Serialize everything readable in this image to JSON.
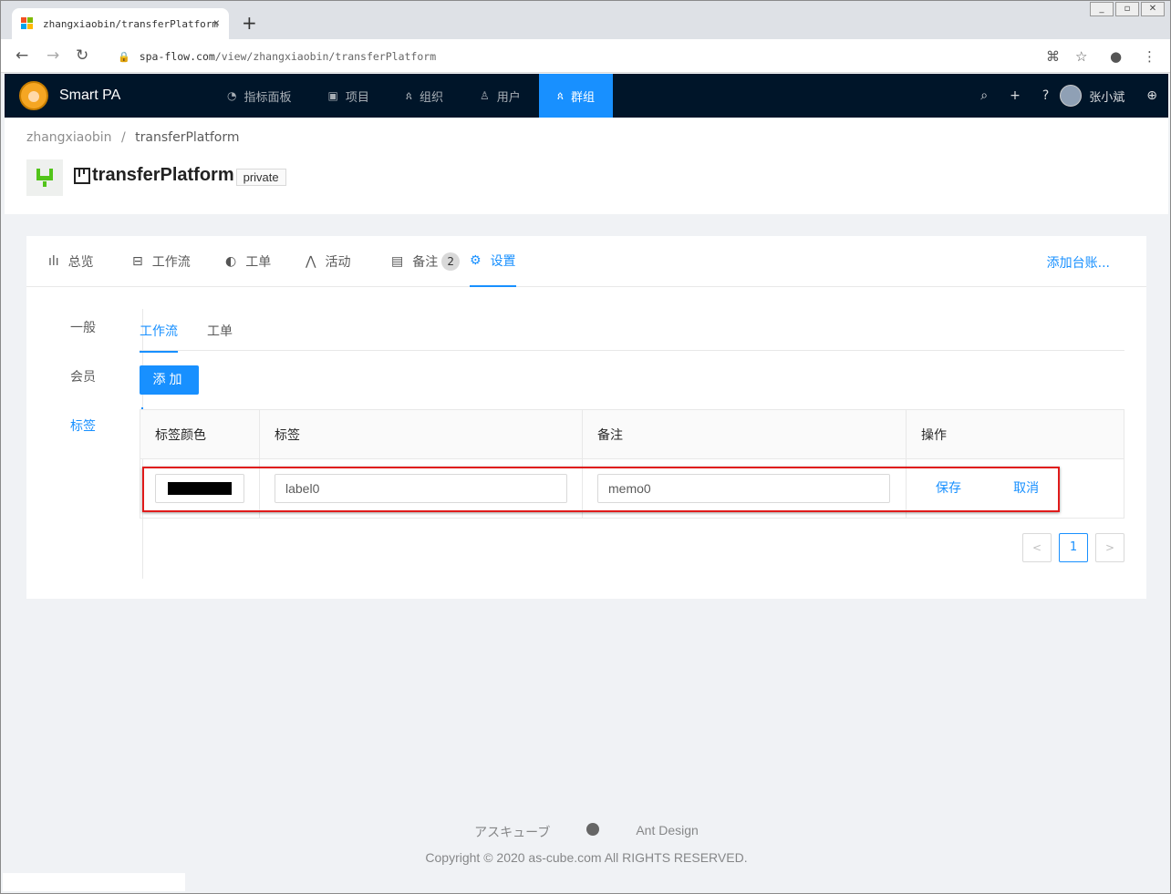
{
  "browser": {
    "tab_title": "zhangxiaobin/transferPlatform",
    "tab_close": "×",
    "new_tab": "+",
    "url_host": "spa-flow.com",
    "url_path": "/view/zhangxiaobin/transferPlatform",
    "back_icon": "←",
    "forward_icon": "→",
    "reload_icon": "↻",
    "lock_icon": "🔒",
    "translate_icon": "⌘",
    "star_icon": "☆",
    "account_icon": "●",
    "menu_icon": "⋮"
  },
  "app": {
    "name": "Smart PA",
    "menu": [
      {
        "label": "指标面板",
        "icon": "◔"
      },
      {
        "label": "项目",
        "icon": "▣"
      },
      {
        "label": "组织",
        "icon": "ጰ"
      },
      {
        "label": "用户",
        "icon": "♙"
      },
      {
        "label": "群组",
        "icon": "ጰ"
      }
    ],
    "header_icons": {
      "search": "⌕",
      "add": "+",
      "help": "?",
      "globe": "⊕"
    },
    "user_name": "张小斌"
  },
  "page": {
    "breadcrumb": [
      "zhangxiaobin",
      "/",
      "transferPlatform"
    ],
    "project_name": "transferPlatform",
    "visibility": "private"
  },
  "card": {
    "tabs": [
      {
        "label": "总览",
        "icon": "ılı"
      },
      {
        "label": "工作流",
        "icon": "⊟"
      },
      {
        "label": "工单",
        "icon": "◐"
      },
      {
        "label": "活动",
        "icon": "⋀"
      },
      {
        "label": "备注",
        "icon": "▤",
        "count": "2"
      },
      {
        "label": "设置",
        "icon": "⚙"
      }
    ],
    "extra": "添加台账..."
  },
  "settings": {
    "side": [
      "一般",
      "会员",
      "标签"
    ],
    "sub_tabs": [
      "工作流",
      "工单"
    ],
    "add_button": "添加"
  },
  "table": {
    "headers": [
      "标签颜色",
      "标签",
      "备注",
      "操作"
    ],
    "row": {
      "color": "#000000",
      "label": "label0",
      "memo": "memo0",
      "save": "保存",
      "cancel": "取消"
    }
  },
  "pagination": {
    "prev": "<",
    "page": "1",
    "next": ">"
  },
  "footer": {
    "links": [
      "アスキューブ",
      "Ant Design"
    ],
    "copyright": "Copyright © 2020 as-cube.com All RIGHTS RESERVED."
  },
  "colors": {
    "primary": "#1890ff",
    "header_bg": "#001529",
    "highlight": "#e01b1b"
  }
}
